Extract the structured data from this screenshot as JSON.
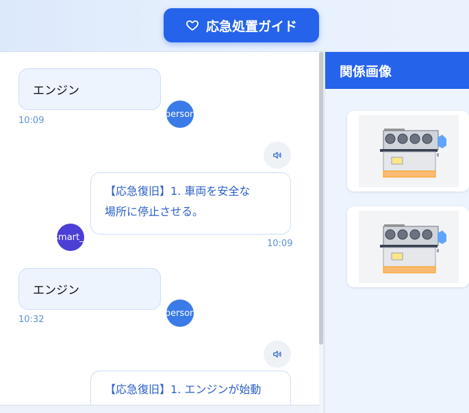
{
  "header": {
    "guide_button_label": "応急処置ガイド"
  },
  "messages": [
    {
      "role": "user",
      "text": "エンジン",
      "time": "10:09",
      "avatar": "person"
    },
    {
      "role": "bot",
      "line1": "【応急復旧】1. 車両を安全な",
      "line2": "場所に停止させる。",
      "time": "10:09",
      "avatar": "smart_t"
    },
    {
      "role": "user",
      "text": "エンジン",
      "time": "10:32",
      "avatar": "person"
    },
    {
      "role": "bot",
      "line1": "【応急復旧】1. エンジンが始動"
    }
  ],
  "sidebar": {
    "title": "関係画像",
    "images": [
      {
        "icon": "engine-diagram"
      },
      {
        "icon": "engine-diagram"
      }
    ]
  },
  "colors": {
    "accent": "#2563eb",
    "user_bubble": "#eef4fe",
    "bot_text": "#2b5fc9",
    "bot_avatar": "#4c3fd6",
    "person_avatar": "#3b7be8"
  }
}
